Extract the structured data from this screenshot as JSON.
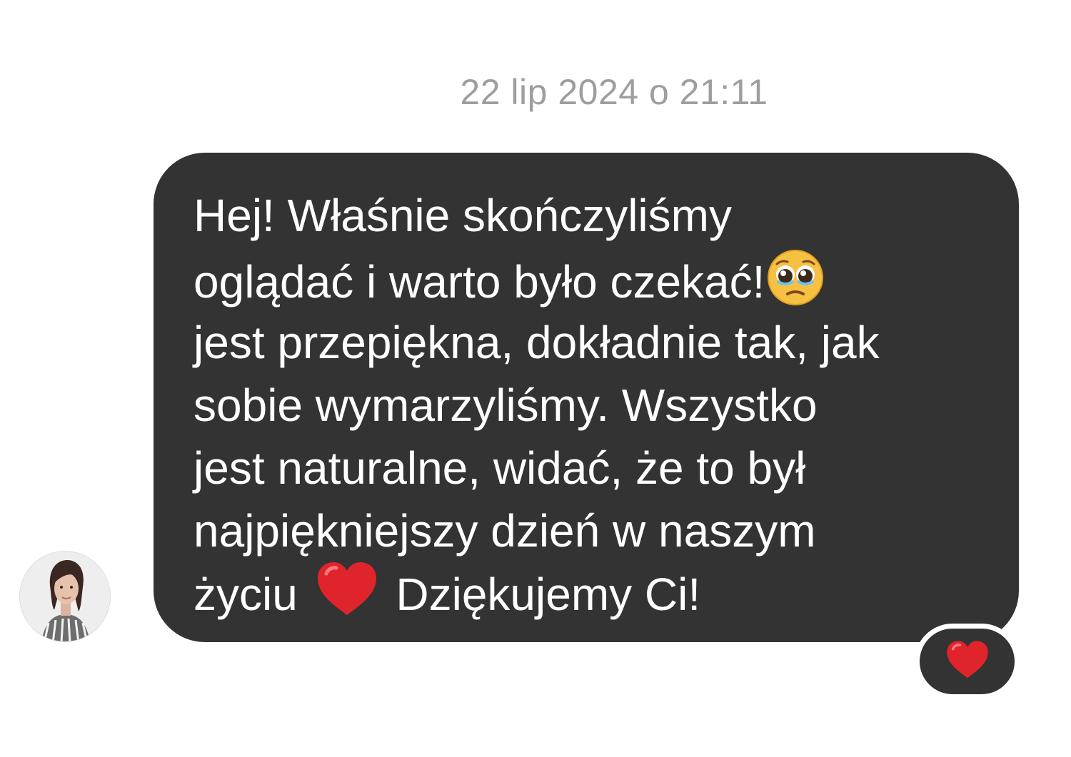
{
  "timestamp": "22 lip 2024 o 21:11",
  "message": {
    "lines": [
      "Hej! Właśnie skończyliśmy",
      "oglądać i warto było czekać!",
      "jest przepiękna, dokładnie tak, jak",
      "sobie wymarzyliśmy. Wszystko",
      "jest naturalne, widać, że to był",
      "najpiękniejszy dzień w naszym",
      "życiu",
      "Dziękujemy Ci!"
    ],
    "inline_emojis": [
      "pleading-face-icon",
      "red-heart-icon"
    ]
  },
  "reaction": {
    "emoji": "red-heart-icon"
  },
  "colors": {
    "bubble": "#333333",
    "text": "#ffffff",
    "timestamp": "#9e9e9e",
    "heart": "#e0242b",
    "emoji_face": "#f5b935"
  }
}
